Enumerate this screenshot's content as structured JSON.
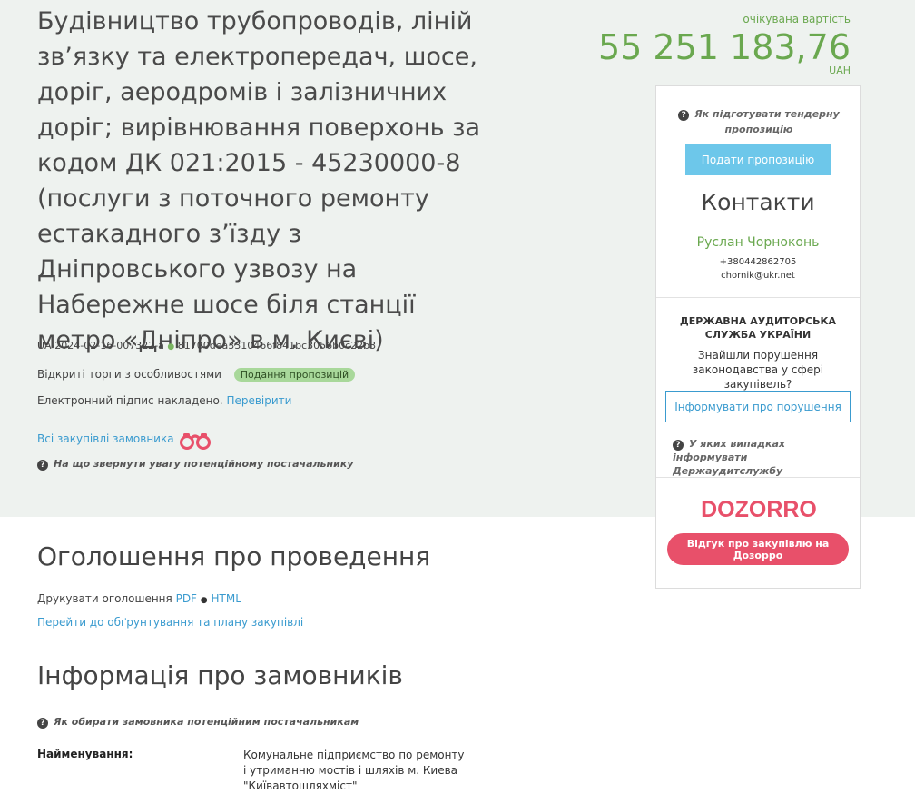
{
  "tender": {
    "title": "Будівництво трубопроводів, ліній зв’язку та електропередач, шосе, доріг, аеродромів і залізничних доріг; вирівнювання поверхонь за кодом ДК 021:2015 - 45230000-8 (послуги з поточного ремонту естакадного з’їзду з Дніпровського узвозу на Набережне шосе біля станції метро «Дніпро» в м. Києві)",
    "id": "UA-2024-02-16-007322-a",
    "id_separator": "●",
    "hash": "81700dea3310466f841bc3056b0c22b3",
    "procedure": "Відкриті торги з особливостями",
    "status_badge": "Подання пропозицій",
    "signature_text": "Електронний підпис накладено.",
    "verify_link": "Перевірити",
    "all_purchases_link": "Всі закупівлі замовника",
    "supplier_hint": "На що звернути увагу потенційному постачальнику"
  },
  "price": {
    "label": "очікувана вартість",
    "amount": "55 251 183,76",
    "currency": "UAH"
  },
  "sidebar": {
    "tender_hint": "Як підготувати тендерну пропозицію",
    "propose_button": "Подати пропозицію",
    "contacts_title": "Контакти",
    "contact_name": "Руслан Чорноконь",
    "contact_phone": "+380442862705",
    "contact_email": "chornik@ukr.net",
    "audit_title": "ДЕРЖАВНА АУДИТОРСЬКА СЛУЖБА УКРАЇНИ",
    "audit_text": "Знайшли порушення законодавства у сфері закупівель?",
    "inform_button": "Інформувати про порушення",
    "audit_hint": "У яких випадках інформувати Держаудитслужбу",
    "dozorro_logo": "DOZORRO",
    "dozorro_button": "Відгук про закупівлю на Дозорро"
  },
  "announcement": {
    "title": "Оголошення про проведення",
    "print_label": "Друкувати оголошення",
    "pdf_link": "PDF",
    "separator": "●",
    "html_link": "HTML",
    "plan_link": "Перейти до обґрунтування та плану закупівлі"
  },
  "customer": {
    "title": "Інформація про замовників",
    "hint": "Як обирати замовника потенційним постачальникам",
    "name_label": "Найменування:",
    "name_value": "Комунальне підприємство по ремонту і утриманню мостів і шляхів м. Киева \"Київавтошляхміст\""
  },
  "colors": {
    "accent_green": "#6aa84f",
    "link_blue": "#3a9bcf",
    "propose_button": "#6dc7ea",
    "dozorro_pink": "#e8506a",
    "hero_background": "#eef2ef"
  },
  "icons": {
    "help": "question-circle-icon",
    "binoculars": "binoculars-icon"
  }
}
